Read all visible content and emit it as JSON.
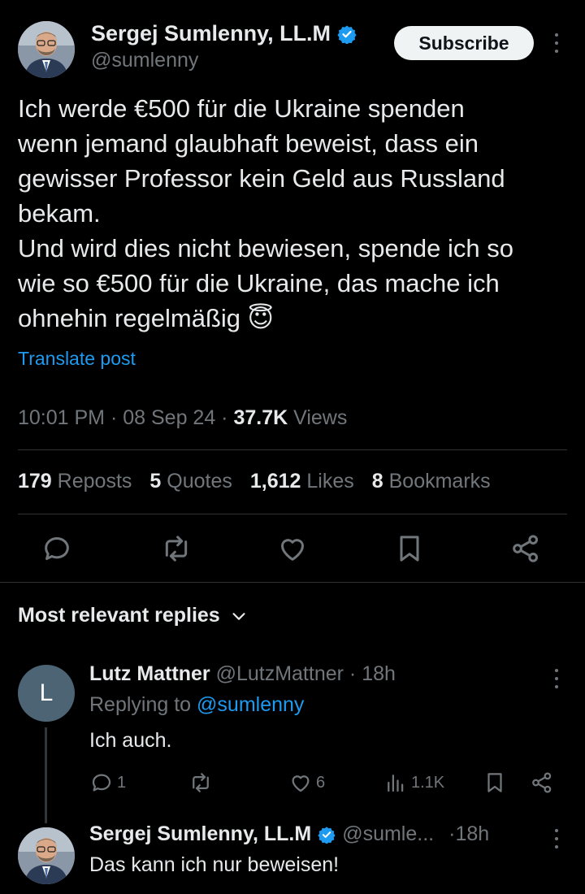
{
  "post": {
    "author_name": "Sergej Sumlenny, LL.M",
    "author_handle": "@sumlenny",
    "subscribe_label": "Subscribe",
    "text_lines": [
      "Ich werde €500 für die Ukraine spenden",
      "wenn jemand glaubhaft beweist, dass ein",
      "gewisser Professor kein Geld aus Russland",
      "bekam.",
      "Und wird dies nicht bewiesen, spende ich so",
      "wie so €500 für die Ukraine, das mache ich",
      "ohnehin regelmäßig 😇"
    ],
    "translate_label": "Translate post",
    "time": "10:01 PM",
    "date": "08 Sep 24",
    "views_count": "37.7K",
    "views_label": "Views",
    "stats": {
      "reposts_count": "179",
      "reposts_label": "Reposts",
      "quotes_count": "5",
      "quotes_label": "Quotes",
      "likes_count": "1,612",
      "likes_label": "Likes",
      "bookmarks_count": "8",
      "bookmarks_label": "Bookmarks"
    }
  },
  "replies_header": "Most relevant replies",
  "replies": [
    {
      "avatar_letter": "L",
      "name": "Lutz Mattner",
      "handle": "@LutzMattner",
      "time": "18h",
      "replying_label": "Replying to",
      "replying_handle": "@sumlenny",
      "text": "Ich auch.",
      "reply_count": "1",
      "like_count": "6",
      "view_count": "1.1K"
    },
    {
      "name": "Sergej Sumlenny, LL.M",
      "handle": "@sumle...",
      "time": "18h",
      "text": "Das kann ich nur beweisen!"
    }
  ],
  "colors": {
    "accent": "#1d9bf0",
    "muted": "#71767b",
    "text": "#e7e9ea",
    "background": "#000000"
  },
  "icons": [
    "verified-badge-icon",
    "more-icon",
    "reply-icon",
    "repost-icon",
    "like-icon",
    "bookmark-icon",
    "share-icon",
    "views-icon",
    "chevron-down-icon"
  ]
}
